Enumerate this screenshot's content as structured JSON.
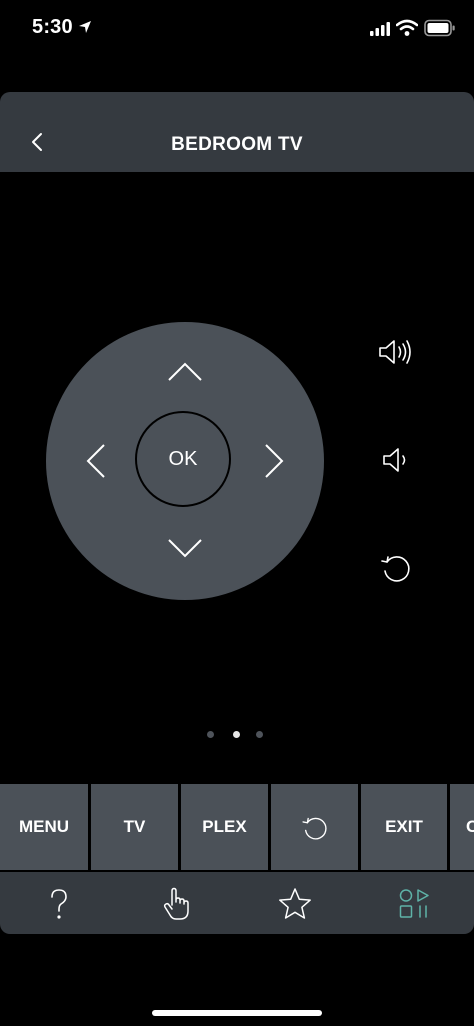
{
  "status_bar": {
    "time": "5:30",
    "icons": [
      "location-arrow-icon",
      "signal-icon",
      "wifi-icon",
      "battery-icon"
    ]
  },
  "header": {
    "title": "BEDROOM TV",
    "back_icon": "chevron-left-icon"
  },
  "dpad": {
    "ok_label": "OK",
    "icons": [
      "chevron-up-icon",
      "chevron-down-icon",
      "chevron-left-icon",
      "chevron-right-icon"
    ]
  },
  "side_controls": [
    "volume-up-icon",
    "volume-down-icon",
    "replay-icon"
  ],
  "pagination": {
    "total": 3,
    "active": 2
  },
  "button_row": [
    {
      "label": "MENU"
    },
    {
      "label": "TV"
    },
    {
      "label": "PLEX"
    },
    {
      "label": "",
      "icon": "replay-icon"
    },
    {
      "label": "EXIT"
    },
    {
      "label": "C"
    }
  ],
  "bottom_tabs": [
    {
      "icon": "question-icon",
      "active": false
    },
    {
      "icon": "hand-pointer-icon",
      "active": false
    },
    {
      "icon": "star-icon",
      "active": false
    },
    {
      "icon": "shapes-controls-icon",
      "active": true
    }
  ],
  "colors": {
    "background": "#000000",
    "header": "#353a40",
    "button": "#4b5158",
    "accent": "#5fb3a8",
    "text": "#ffffff"
  }
}
